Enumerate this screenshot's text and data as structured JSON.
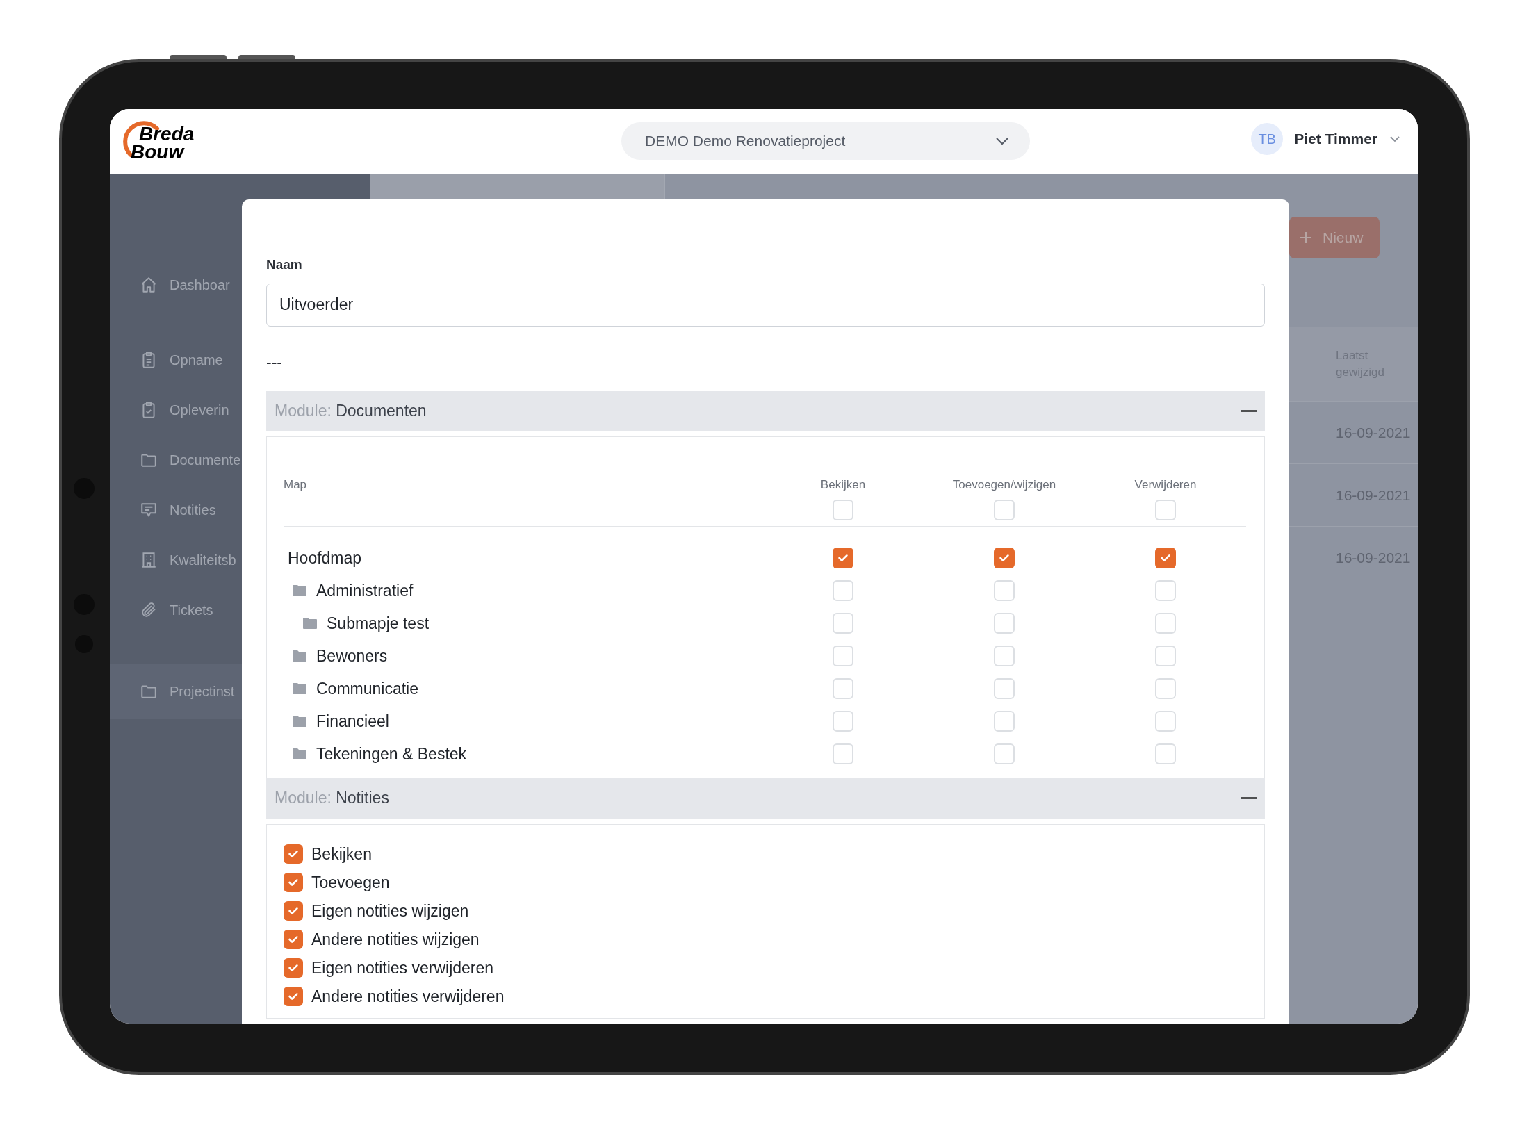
{
  "header": {
    "logo": {
      "line_1": "Breda",
      "line_2": "Bouw"
    },
    "project_select": "DEMO Demo Renovatieproject",
    "user_initials": "TB",
    "user_name": "Piet Timmer"
  },
  "sidebar": {
    "items": [
      {
        "label": "Dashboar",
        "selected": false
      },
      {
        "label": "Opname",
        "selected": false
      },
      {
        "label": "Opleverin",
        "selected": false
      },
      {
        "label": "Documente",
        "selected": false
      },
      {
        "label": "Notities",
        "selected": false
      },
      {
        "label": "Kwaliteitsb",
        "selected": false
      },
      {
        "label": "Tickets",
        "selected": false
      },
      {
        "label": "Projectinst",
        "selected": true
      }
    ]
  },
  "background_page": {
    "new_button": "Nieuw",
    "table": {
      "column": "Laatst gewijzigd",
      "rows": [
        "16-09-2021",
        "16-09-2021",
        "16-09-2021"
      ]
    }
  },
  "modal": {
    "name_label": "Naam",
    "name_value": "Uitvoerder",
    "separator": "---",
    "modules": [
      {
        "kind": "folders",
        "prefix": "Module:",
        "name": "Documenten",
        "expanded": true,
        "columns": [
          "Map",
          "Bekijken",
          "Toevoegen/wijzigen",
          "Verwijderen"
        ],
        "header_checks": [
          false,
          false,
          false
        ],
        "folders": [
          {
            "name": "Hoofdmap",
            "checks": [
              true,
              true,
              true
            ],
            "children": [
              {
                "name": "Administratief",
                "checks": [
                  false,
                  false,
                  false
                ],
                "children": [
                  {
                    "name": "Submapje test",
                    "checks": [
                      false,
                      false,
                      false
                    ]
                  }
                ]
              },
              {
                "name": "Bewoners",
                "checks": [
                  false,
                  false,
                  false
                ]
              },
              {
                "name": "Communicatie",
                "checks": [
                  false,
                  false,
                  false
                ]
              },
              {
                "name": "Financieel",
                "checks": [
                  false,
                  false,
                  false
                ]
              },
              {
                "name": "Tekeningen & Bestek",
                "checks": [
                  false,
                  false,
                  false
                ]
              }
            ]
          }
        ]
      },
      {
        "kind": "checklist",
        "prefix": "Module:",
        "name": "Notities",
        "expanded": true,
        "items": [
          {
            "label": "Bekijken",
            "checked": true
          },
          {
            "label": "Toevoegen",
            "checked": true
          },
          {
            "label": "Eigen notities wijzigen",
            "checked": true
          },
          {
            "label": "Andere notities wijzigen",
            "checked": true
          },
          {
            "label": "Eigen notities verwijderen",
            "checked": true
          },
          {
            "label": "Andere notities verwijderen",
            "checked": true
          }
        ]
      }
    ]
  }
}
